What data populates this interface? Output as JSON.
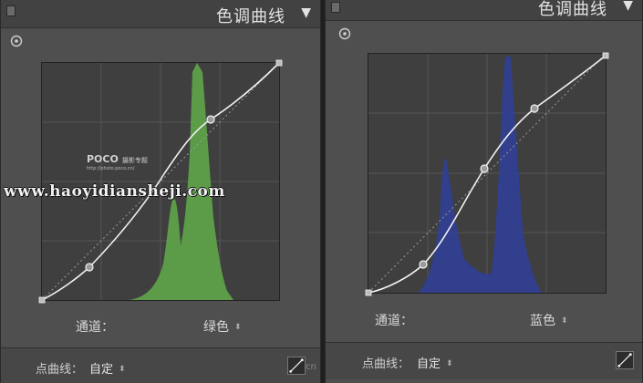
{
  "panels": [
    {
      "title": "色调曲线",
      "channel_label": "通道：",
      "channel_value": "绿色",
      "point_curve_label": "点曲线：",
      "point_curve_value": "自定",
      "histogram_color": "#5fa64a"
    },
    {
      "title": "色调曲线",
      "channel_label": "通道：",
      "channel_value": "蓝色",
      "point_curve_label": "点曲线：",
      "point_curve_value": "自定",
      "histogram_color": "#2f3f9a"
    }
  ],
  "overlays": {
    "watermark": "www.haoyidiansheji.com",
    "poco_brand": "POCO",
    "poco_tag": "摄影专题",
    "poco_url": "http://photo.poco.cn/",
    "corner_mark": "cn"
  },
  "icons": {
    "header_arrow": "triangle-down-icon",
    "target": "target-adjustment-icon",
    "select_arrows": "up-down-chevron-icon",
    "curve_button": "diagonal-curve-icon"
  }
}
